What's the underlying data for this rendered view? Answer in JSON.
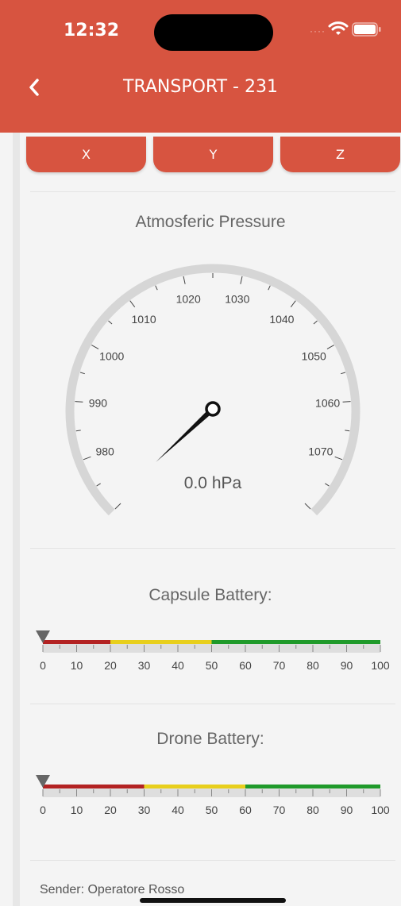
{
  "status_bar": {
    "time": "12:32"
  },
  "header": {
    "title": "TRANSPORT - 231",
    "back_icon": "chevron-left-icon",
    "background": "#d75440"
  },
  "axis_tabs": {
    "x": "X",
    "y": "Y",
    "z": "Z"
  },
  "pressure_gauge": {
    "title": "Atmosferic Pressure",
    "min": 970,
    "max": 1080,
    "tick_labels": [
      "980",
      "990",
      "1000",
      "1010",
      "1020",
      "1030",
      "1040",
      "1050",
      "1060",
      "1070"
    ],
    "readout": "0.0 hPa",
    "value": 0.0
  },
  "capsule_battery": {
    "title": "Capsule Battery:",
    "value": 0,
    "ticks": [
      "0",
      "10",
      "20",
      "30",
      "40",
      "50",
      "60",
      "70",
      "80",
      "90",
      "100"
    ],
    "ranges": [
      {
        "from": 0,
        "to": 20,
        "color": "#b32222"
      },
      {
        "from": 20,
        "to": 50,
        "color": "#e8cf1c"
      },
      {
        "from": 50,
        "to": 100,
        "color": "#1f9a2a"
      }
    ]
  },
  "drone_battery": {
    "title": "Drone Battery:",
    "value": 0,
    "ticks": [
      "0",
      "10",
      "20",
      "30",
      "40",
      "50",
      "60",
      "70",
      "80",
      "90",
      "100"
    ],
    "ranges": [
      {
        "from": 0,
        "to": 30,
        "color": "#b32222"
      },
      {
        "from": 30,
        "to": 60,
        "color": "#e8cf1c"
      },
      {
        "from": 60,
        "to": 100,
        "color": "#1f9a2a"
      }
    ]
  },
  "sender": "Sender: Operatore Rosso"
}
